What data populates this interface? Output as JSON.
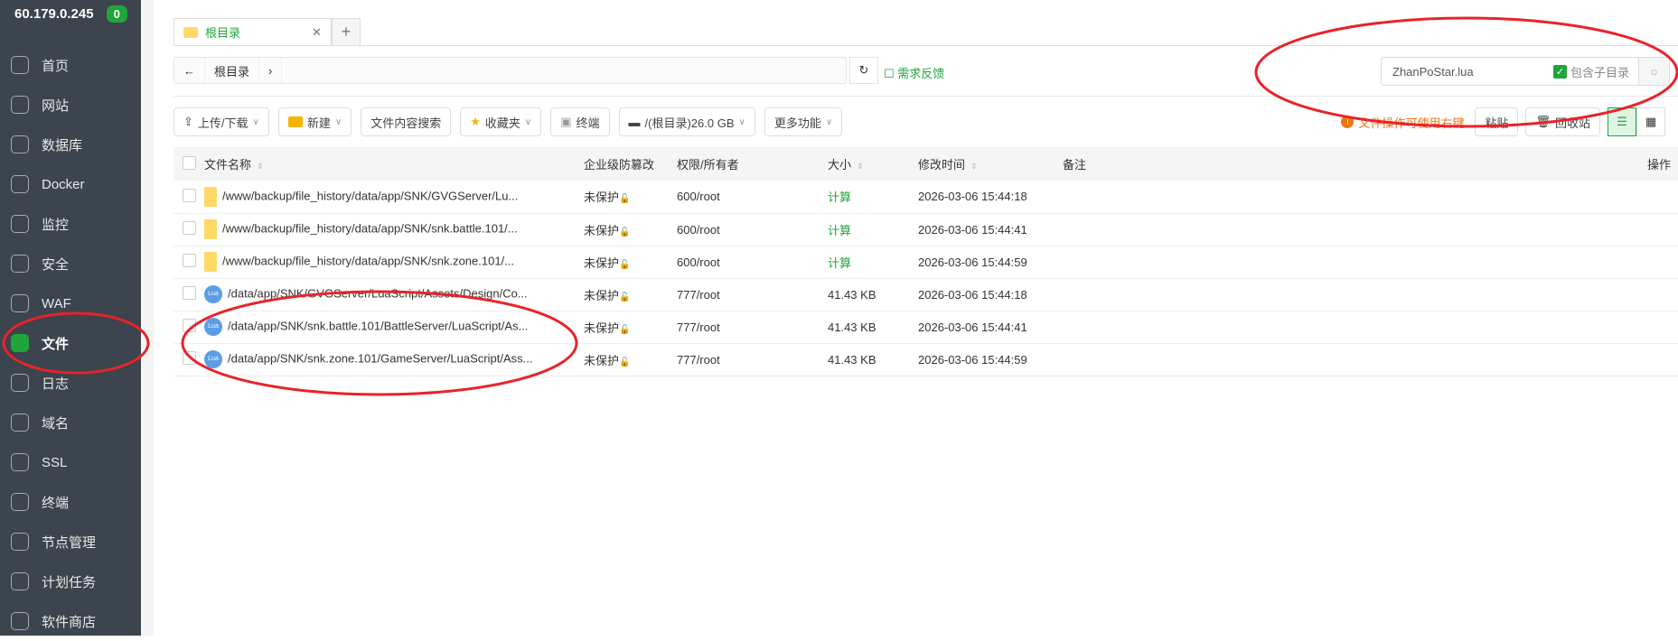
{
  "server": {
    "host": "60.179.0.245",
    "badge": "0"
  },
  "sidebar": {
    "items": [
      {
        "label": "首页",
        "icon": "home-icon"
      },
      {
        "label": "网站",
        "icon": "website-icon"
      },
      {
        "label": "数据库",
        "icon": "database-icon"
      },
      {
        "label": "Docker",
        "icon": "docker-icon"
      },
      {
        "label": "监控",
        "icon": "monitor-icon"
      },
      {
        "label": "安全",
        "icon": "shield-icon"
      },
      {
        "label": "WAF",
        "icon": "waf-icon"
      },
      {
        "label": "文件",
        "icon": "folder-icon",
        "active": true
      },
      {
        "label": "日志",
        "icon": "log-icon"
      },
      {
        "label": "域名",
        "icon": "globe-icon"
      },
      {
        "label": "SSL",
        "icon": "ssl-icon"
      },
      {
        "label": "终端",
        "icon": "terminal-icon"
      },
      {
        "label": "节点管理",
        "icon": "node-icon"
      },
      {
        "label": "计划任务",
        "icon": "calendar-icon"
      },
      {
        "label": "软件商店",
        "icon": "store-icon"
      }
    ]
  },
  "tabs": [
    {
      "label": "根目录"
    }
  ],
  "breadcrumb": {
    "root": "根目录"
  },
  "feedback": "需求反馈",
  "search": {
    "value": "ZhanPoStar.lua",
    "subdir_label": "包含子目录",
    "subdir_checked": true
  },
  "toolbar": {
    "upload": "上传/下载",
    "new": "新建",
    "content_search": "文件内容搜索",
    "favorites": "收藏夹",
    "terminal": "终端",
    "disk": "/(根目录)26.0 GB",
    "more": "更多功能"
  },
  "tip": "文件操作可使用右键",
  "paste": "粘贴",
  "recycle": "回收站",
  "table": {
    "headers": {
      "name": "文件名称",
      "protect": "企业级防篡改",
      "perm": "权限/所有者",
      "size": "大小",
      "mtime": "修改时间",
      "note": "备注",
      "ops": "操作"
    },
    "rows": [
      {
        "type": "folder",
        "name": "/www/backup/file_history/data/app/SNK/GVGServer/Lu...",
        "protect": "未保护",
        "perm": "600/root",
        "size": "计算",
        "mtime": "2026-03-06 15:44:18"
      },
      {
        "type": "folder",
        "name": "/www/backup/file_history/data/app/SNK/snk.battle.101/...",
        "protect": "未保护",
        "perm": "600/root",
        "size": "计算",
        "mtime": "2026-03-06 15:44:41"
      },
      {
        "type": "folder",
        "name": "/www/backup/file_history/data/app/SNK/snk.zone.101/...",
        "protect": "未保护",
        "perm": "600/root",
        "size": "计算",
        "mtime": "2026-03-06 15:44:59"
      },
      {
        "type": "lua",
        "name": "/data/app/SNK/GVGServer/LuaScript/Assets/Design/Co...",
        "protect": "未保护",
        "perm": "777/root",
        "size": "41.43 KB",
        "mtime": "2026-03-06 15:44:18"
      },
      {
        "type": "lua",
        "name": "/data/app/SNK/snk.battle.101/BattleServer/LuaScript/As...",
        "protect": "未保护",
        "perm": "777/root",
        "size": "41.43 KB",
        "mtime": "2026-03-06 15:44:41"
      },
      {
        "type": "lua",
        "name": "/data/app/SNK/snk.zone.101/GameServer/LuaScript/Ass...",
        "protect": "未保护",
        "perm": "777/root",
        "size": "41.43 KB",
        "mtime": "2026-03-06 15:44:59"
      }
    ]
  },
  "colors": {
    "accent": "#20a53a",
    "sidebar": "#3c444d",
    "warning": "#f0750f",
    "annotation": "#e8232a"
  }
}
